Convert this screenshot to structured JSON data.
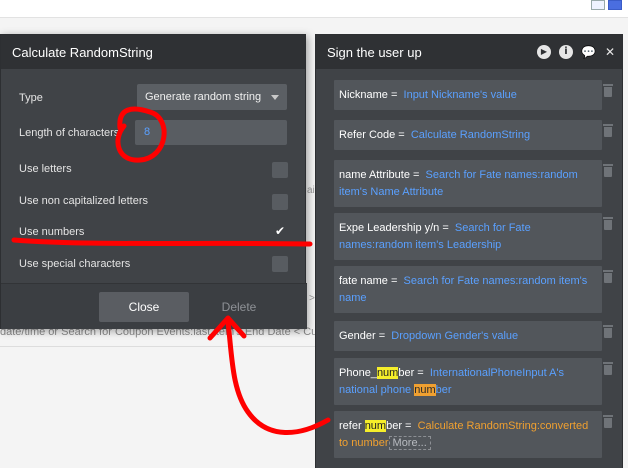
{
  "background": {
    "coupon_text": "date/time or Search for Coupon Events:last item's End Date < Cu",
    "fragment_1": "ai",
    "fragment_2": ">"
  },
  "calc_panel": {
    "title": "Calculate RandomString",
    "type_label": "Type",
    "type_value": "Generate random string",
    "length_label": "Length of characters",
    "length_value": "8",
    "options": [
      {
        "label": "Use letters",
        "checked": false
      },
      {
        "label": "Use non capitalized letters",
        "checked": false
      },
      {
        "label": "Use numbers",
        "checked": true,
        "mark": "✔"
      },
      {
        "label": "Use special characters",
        "checked": false
      }
    ],
    "close_label": "Close",
    "delete_label": "Delete"
  },
  "signup_panel": {
    "title": "Sign the user up",
    "fields": [
      {
        "key": "Nickname =",
        "value": "Input Nickname's value"
      },
      {
        "key": "Refer Code =",
        "value": "Calculate RandomString"
      },
      {
        "key": "name Attribute =",
        "value": "Search for Fate names:random item's Name Attribute"
      },
      {
        "key": "Expe Leadership y/n =",
        "value": "Search for Fate names:random item's Leadership"
      },
      {
        "key": "fate name =",
        "value": "Search for Fate names:random item's name"
      },
      {
        "key": "Gender =",
        "value": "Dropdown Gender's value"
      },
      {
        "key_pre": "Phone_",
        "key_hl": "num",
        "key_post": "ber =",
        "value_pre": "InternationalPhoneInput A's national phone ",
        "value_hl": "num",
        "value_post": "ber"
      },
      {
        "key_pre": "refer ",
        "key_hl": "num",
        "key_post": "ber =",
        "value": "Calculate RandomString:converted to number",
        "more": "More..."
      }
    ]
  },
  "annotation": {
    "color": "#ff0000"
  }
}
